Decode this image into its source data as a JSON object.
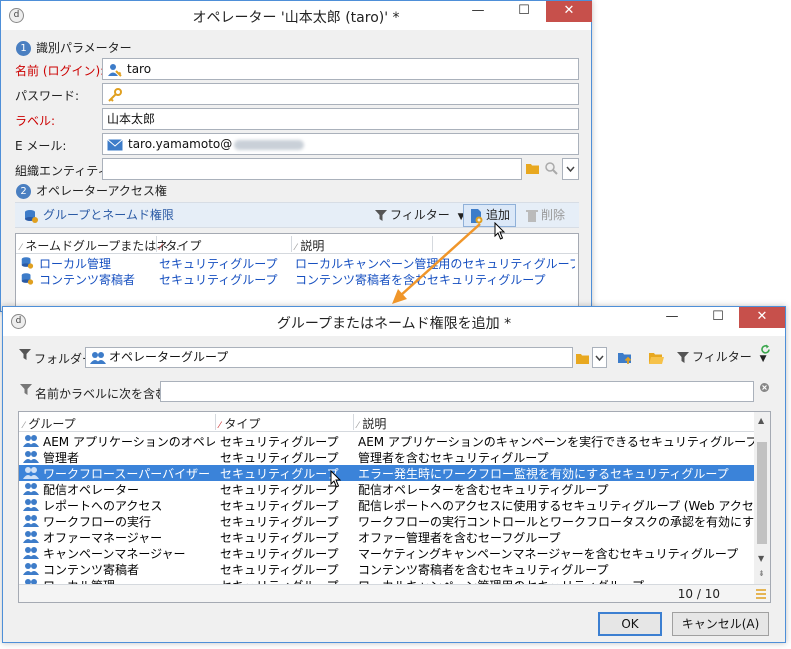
{
  "operator_window": {
    "title": "オペレーター '山本太郎 (taro)' *",
    "controls": {
      "minimize": "—",
      "maximize": "☐",
      "close": "✕"
    },
    "section1": {
      "number": "1",
      "title": "識別パラメーター"
    },
    "fields": {
      "login_label": "名前 (ログイン):",
      "login_value": "taro",
      "password_label": "パスワード:",
      "label_label": "ラベル:",
      "label_value": "山本太郎",
      "email_label": "E メール:",
      "email_value": "taro.yamamoto@",
      "org_label": "組織エンティティ:"
    },
    "section2": {
      "number": "2",
      "title": "オペレーターアクセス権"
    },
    "toolbar": {
      "rights_tab": "グループとネームド権限",
      "filter": "フィルター",
      "add": "追加",
      "delete": "削除"
    },
    "grid": {
      "columns": [
        "ネームドグループまたはネ...",
        "タイプ",
        "説明"
      ],
      "rows": [
        {
          "name": "ローカル管理",
          "type": "セキュリティグループ",
          "desc": "ローカルキャンペーン管理用のセキュリティグループ"
        },
        {
          "name": "コンテンツ寄稿者",
          "type": "セキュリティグループ",
          "desc": "コンテンツ寄稿者を含むセキュリティグループ"
        }
      ]
    }
  },
  "add_dialog": {
    "title": "グループまたはネームド権限を追加 *",
    "controls": {
      "minimize": "—",
      "maximize": "☐",
      "close": "✕"
    },
    "folder_label": "フォルダー:",
    "folder_value": "オペレーターグループ",
    "filter": "フィルター",
    "search_label": "名前かラベルに次を含む:",
    "search_value": "",
    "columns": [
      "グループ",
      "タイプ",
      "説明"
    ],
    "rows": [
      {
        "name": "AEM アプリケーションのオペレーター",
        "type": "セキュリティグループ",
        "desc": "AEM アプリケーションのキャンペーンを実行できるセキュリティグループ"
      },
      {
        "name": "管理者",
        "type": "セキュリティグループ",
        "desc": "管理者を含むセキュリティグループ"
      },
      {
        "name": "ワークフロースーパーバイザー",
        "type": "セキュリティグループ",
        "desc": "エラー発生時にワークフロー監視を有効にするセキュリティグループ",
        "selected": true
      },
      {
        "name": "配信オペレーター",
        "type": "セキュリティグループ",
        "desc": "配信オペレーターを含むセキュリティグループ"
      },
      {
        "name": "レポートへのアクセス",
        "type": "セキュリティグループ",
        "desc": "配信レポートへのアクセスに使用するセキュリティグループ (Web アクセスから .../nl/js"
      },
      {
        "name": "ワークフローの実行",
        "type": "セキュリティグループ",
        "desc": "ワークフローの実行コントロールとワークフロータスクの承認を有効にするセキュリティグ..."
      },
      {
        "name": "オファーマネージャー",
        "type": "セキュリティグループ",
        "desc": "オファー管理者を含むセーフグループ"
      },
      {
        "name": "キャンペーンマネージャー",
        "type": "セキュリティグループ",
        "desc": "マーケティングキャンペーンマネージャーを含むセキュリティグループ"
      },
      {
        "name": "コンテンツ寄稿者",
        "type": "セキュリティグループ",
        "desc": "コンテンツ寄稿者を含むセキュリティグループ"
      },
      {
        "name": "ローカル管理",
        "type": "セキュリティグループ",
        "desc": "ローカルキャンペーン管理用のセキュリティグループ"
      }
    ],
    "pagination": "10 / 10",
    "ok": "OK",
    "cancel": "キャンセル(A)"
  },
  "colors": {
    "accent": "#3b83d9",
    "link": "#1750c0",
    "close": "#c7504b",
    "arrow": "#f0962a",
    "required": "#cc0000"
  }
}
